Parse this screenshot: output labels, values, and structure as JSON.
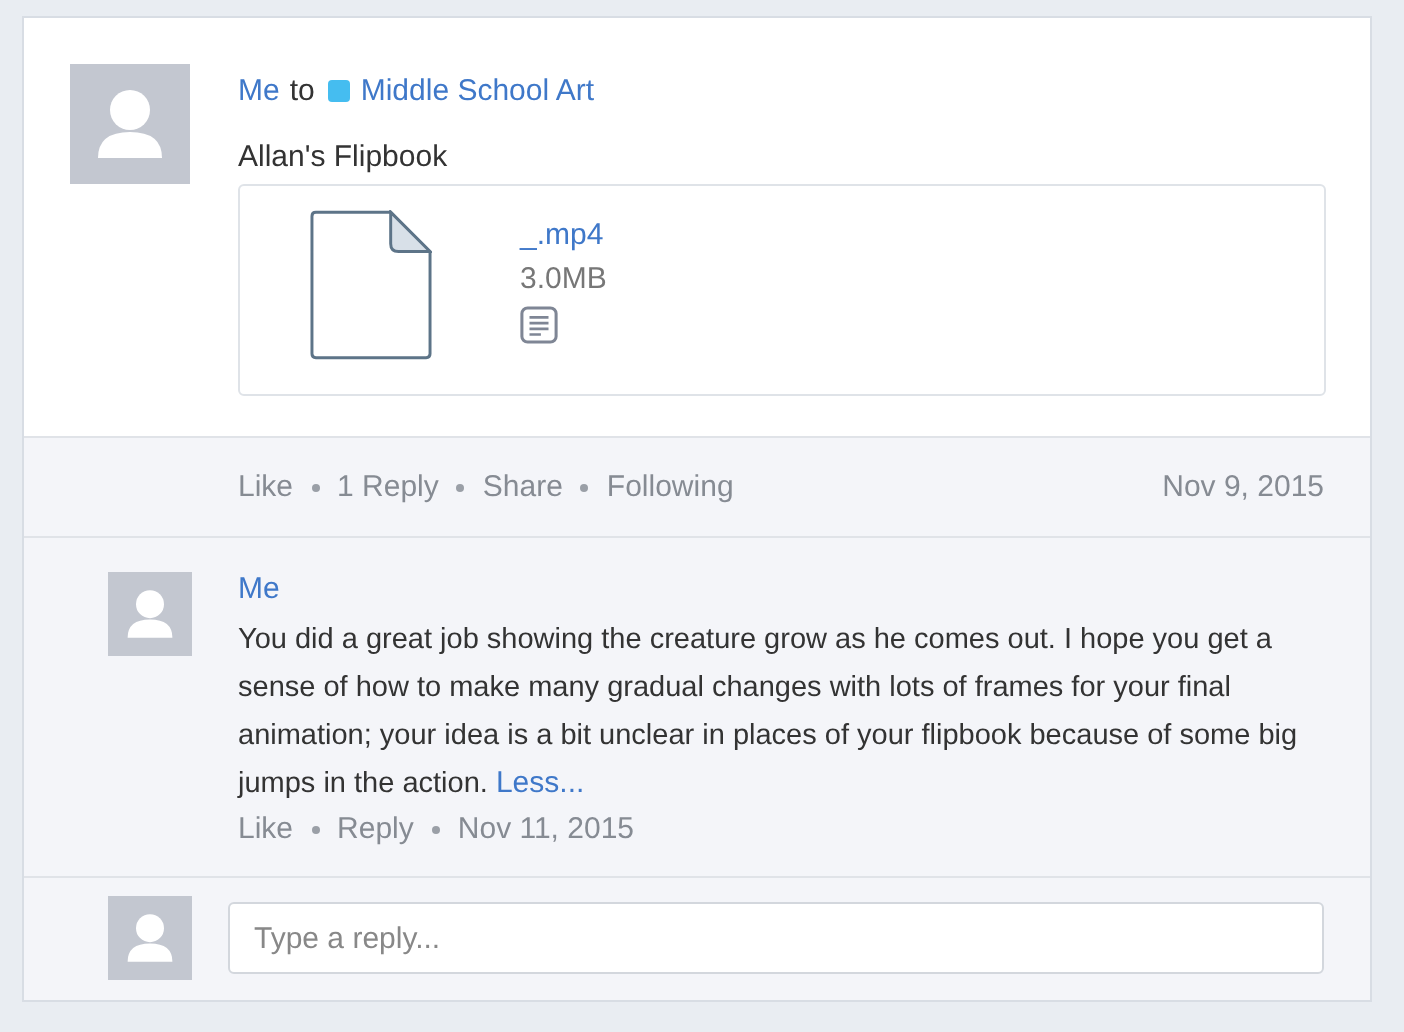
{
  "post": {
    "author": "Me",
    "to": "to",
    "group": "Middle School Art",
    "title": "Allan's Flipbook",
    "attachment": {
      "name": "_.mp4",
      "size": "3.0MB"
    },
    "actions": [
      "Like",
      "1 Reply",
      "Share",
      "Following"
    ],
    "date": "Nov 9, 2015"
  },
  "comment": {
    "author": "Me",
    "text": "You did a great job showing the creature grow as he comes out. I hope you get a sense of how to make many gradual changes with lots of frames for your final animation; your idea is a bit unclear in places of your flipbook because of some big jumps in the action.",
    "toggle": "Less...",
    "actions": [
      "Like",
      "Reply"
    ],
    "date": "Nov 11, 2015"
  },
  "reply": {
    "placeholder": "Type a reply..."
  }
}
